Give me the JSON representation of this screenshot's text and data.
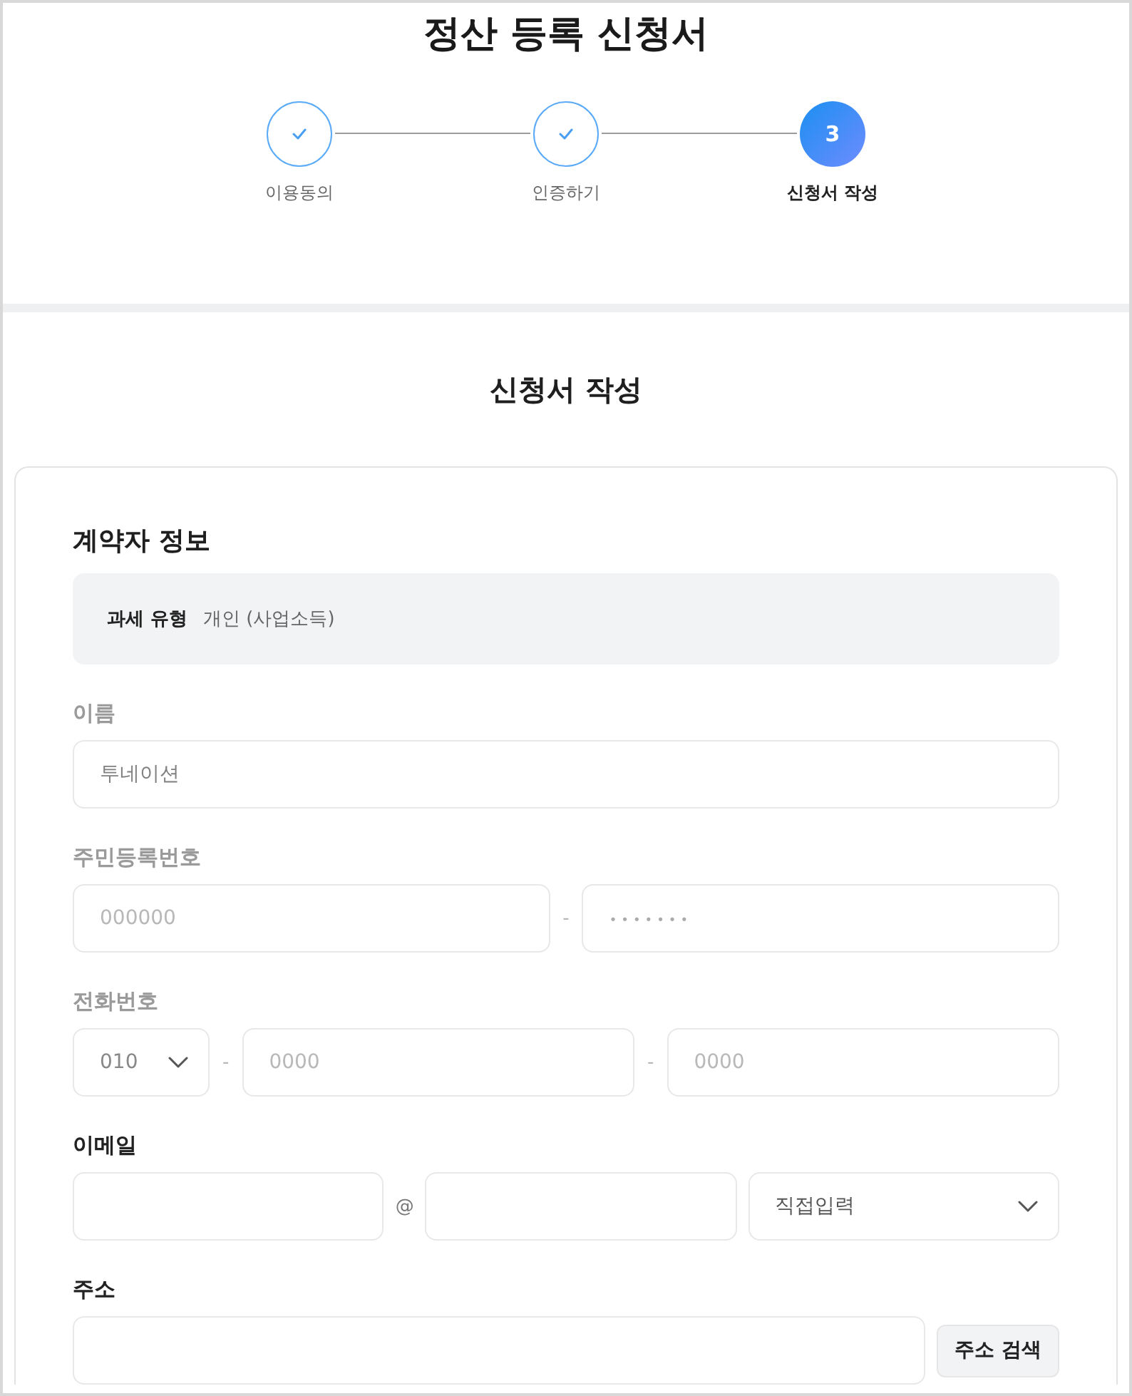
{
  "title": "정산 등록 신청서",
  "steps": [
    {
      "label": "이용동의",
      "completed": true,
      "selected": false
    },
    {
      "label": "인증하기",
      "completed": true,
      "selected": false
    },
    {
      "label": "신청서 작성",
      "number": "3",
      "completed": false,
      "selected": true
    }
  ],
  "section_title": "신청서 작성",
  "contractor": {
    "title": "계약자 정보",
    "tax_type": {
      "label": "과세 유형",
      "value": "개인 (사업소득)"
    },
    "fields": [
      {
        "kind": "single",
        "label": "이름",
        "disabled": true,
        "parts": [
          {
            "kind": "input",
            "value": "투네이션"
          }
        ]
      },
      {
        "kind": "resident",
        "label": "주민등록번호",
        "disabled": true,
        "parts": [
          {
            "kind": "input",
            "placeholder": "000000"
          },
          {
            "kind": "separator",
            "text": "-"
          },
          {
            "kind": "secret",
            "placeholder": "•••••••"
          }
        ]
      },
      {
        "kind": "phone",
        "label": "전화번호",
        "disabled": true,
        "parts": [
          {
            "kind": "select",
            "value": "010"
          },
          {
            "kind": "separator",
            "text": "-"
          },
          {
            "kind": "input",
            "placeholder": "0000"
          },
          {
            "kind": "separator",
            "text": "-"
          },
          {
            "kind": "input",
            "placeholder": "0000"
          }
        ]
      },
      {
        "kind": "email",
        "label": "이메일",
        "disabled": false,
        "parts": [
          {
            "kind": "input"
          },
          {
            "kind": "separator",
            "text": "@"
          },
          {
            "kind": "input"
          },
          {
            "kind": "select",
            "value": "직접입력"
          }
        ]
      },
      {
        "kind": "address",
        "label": "주소",
        "disabled": false,
        "parts": [
          {
            "kind": "input"
          },
          {
            "kind": "button",
            "label": "주소 검색"
          }
        ]
      }
    ]
  }
}
